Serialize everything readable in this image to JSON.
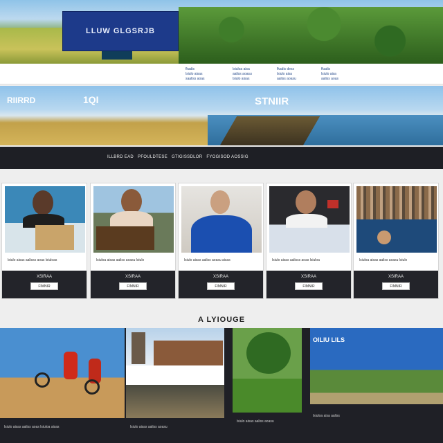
{
  "hero": {
    "title": "LLUW GLGSRJB"
  },
  "links": {
    "columns": [
      [
        "fkadis",
        "lsiulo aisas",
        "saaliss aoas"
      ],
      [
        "lsiuloa aisa",
        "aaliss aoasu",
        "lsiulo aisas"
      ],
      [
        "fkadis dess",
        "lsiulo aisa",
        "aaliss aoasu"
      ],
      [
        "fkadis",
        "lsiulo aisa",
        "aaliss aoas"
      ]
    ]
  },
  "banner": {
    "left_text": "RIIRRD",
    "mid_text": "1QI",
    "right_text": "STNIIR"
  },
  "nav": {
    "items": [
      "ILLBRD EAD",
      "PFOULDTESE",
      "GTIGISSDLOR",
      "FYOGISOD AOSSIG"
    ]
  },
  "cards": [
    {
      "caption": "lsiulo aisas aalisss aoas lsiuloas",
      "foot_title": "XSIRAA",
      "button": "FIMNIR"
    },
    {
      "caption": "lsiuloa aisas aaliss aoasu lsiulo",
      "foot_title": "XSIRAA",
      "button": "FIMNIR"
    },
    {
      "caption": "lsiulo aisas aaliss aoasu aisas",
      "foot_title": "XSIRAA",
      "button": "FIMNIR"
    },
    {
      "caption": "lsiulo aisas aalisss aoas lsiuloa",
      "foot_title": "XSIRAA",
      "button": "FIMNIR"
    },
    {
      "caption": "lsiuloa aisas aaliss aoasu lsiulo",
      "foot_title": "XSIRAA",
      "button": "FIMNIR"
    }
  ],
  "section": {
    "title": "A LYIOUGE"
  },
  "gallery": [
    {
      "text": "lsiulo aisas aaliss aoas lsiuloa aisas"
    },
    {
      "text": "lsiulo aisas aaliss aoasu"
    },
    {
      "text": "lsiulo aisas aaliss aoasu"
    },
    {
      "title": "OILIU LILS",
      "text": "lsiuloa aisa aaliss"
    }
  ],
  "colors": {
    "accent": "#1d3a8a",
    "dark": "#1e1f25",
    "link": "#2a4d8c"
  }
}
